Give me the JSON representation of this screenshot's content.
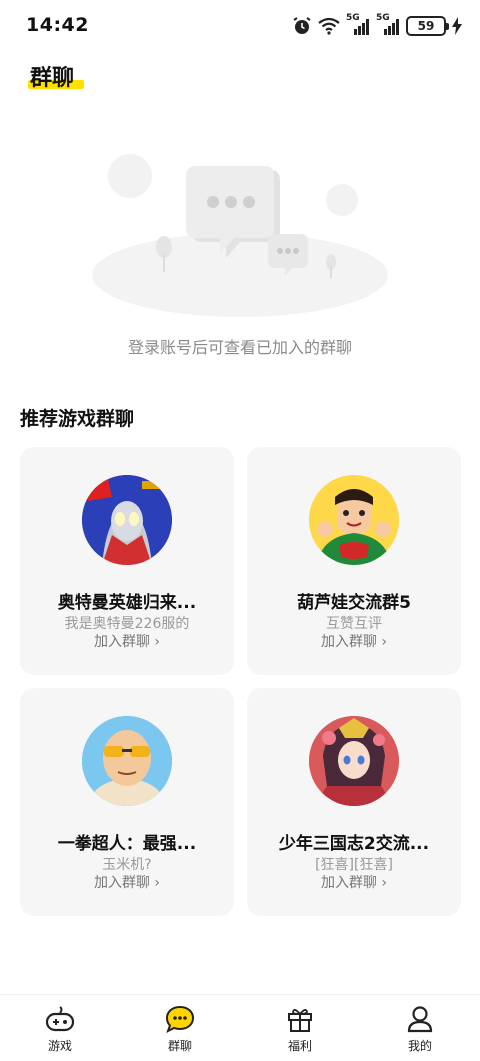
{
  "status_bar": {
    "time": "14:42",
    "battery": "59",
    "icons": [
      "alarm-icon",
      "wifi-icon",
      "signal-5g-icon",
      "signal-5g-icon",
      "battery-icon",
      "charging-icon"
    ],
    "signal_label": "5G"
  },
  "header": {
    "title": "群聊",
    "accent_color": "#ffe100"
  },
  "empty_state": {
    "message": "登录账号后可查看已加入的群聊",
    "icon": "chat-bubbles-illustration"
  },
  "section": {
    "title": "推荐游戏群聊"
  },
  "groups": [
    {
      "name": "奥特曼英雄归来...",
      "desc": "我是奥特曼226服的",
      "join": "加入群聊 ›",
      "avatar": "ultraman-avatar"
    },
    {
      "name": "葫芦娃交流群5",
      "desc": "互赞互评",
      "join": "加入群聊 ›",
      "avatar": "calabash-brothers-avatar"
    },
    {
      "name": "一拳超人：最强...",
      "desc": "玉米机?",
      "join": "加入群聊 ›",
      "avatar": "one-punch-man-avatar"
    },
    {
      "name": "少年三国志2交流...",
      "desc": "[狂喜][狂喜]",
      "join": "加入群聊 ›",
      "avatar": "three-kingdoms-avatar"
    }
  ],
  "bottom_nav": {
    "items": [
      {
        "label": "游戏",
        "icon": "gamepad-icon"
      },
      {
        "label": "群聊",
        "icon": "chat-icon",
        "active": true
      },
      {
        "label": "福利",
        "icon": "gift-icon"
      },
      {
        "label": "我的",
        "icon": "user-icon"
      }
    ]
  }
}
